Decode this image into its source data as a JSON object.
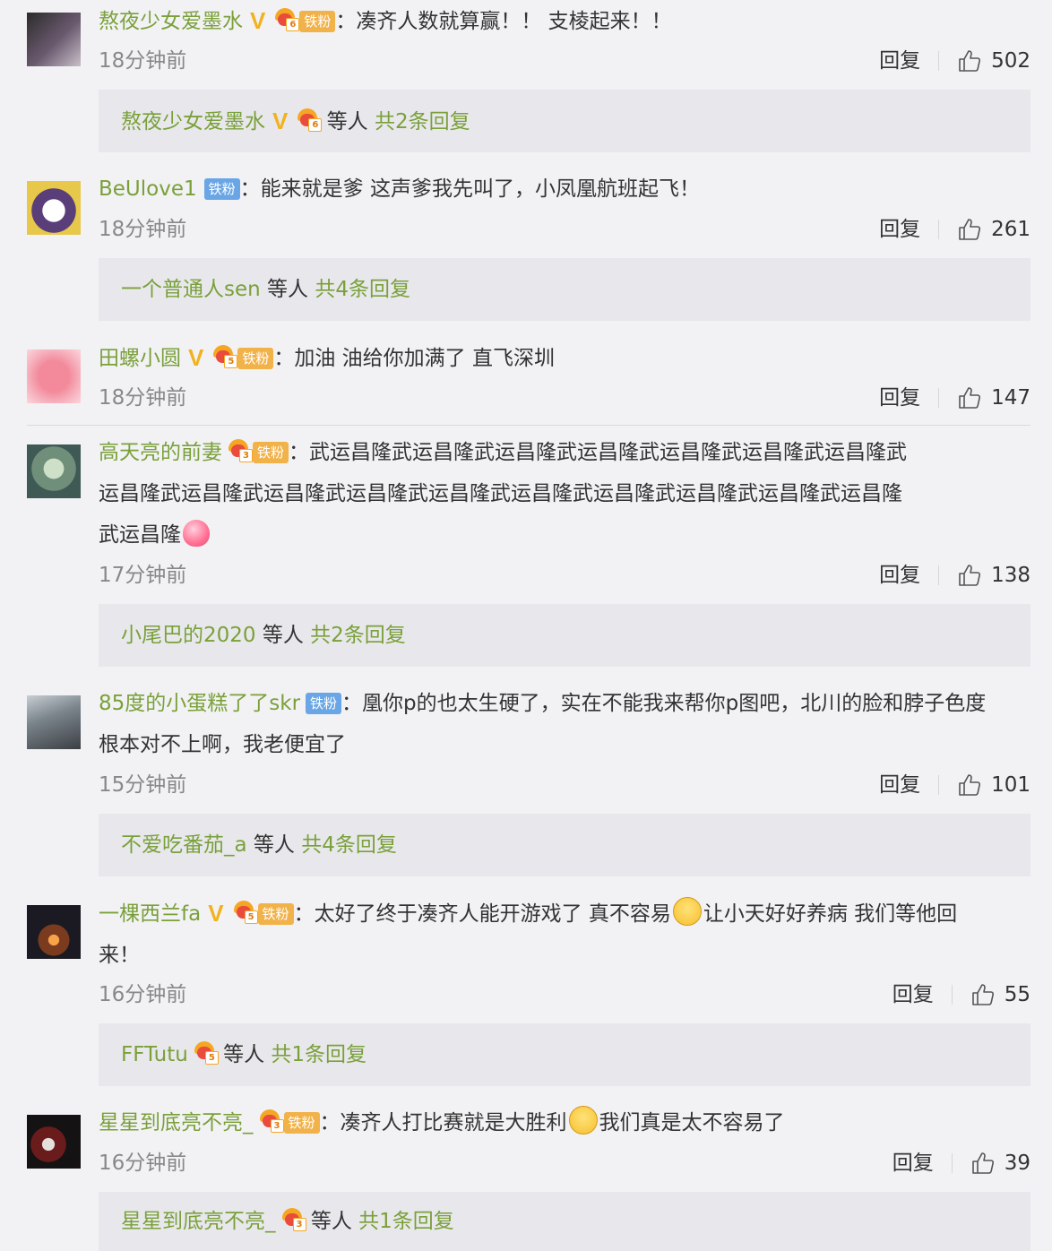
{
  "comments": [
    {
      "username": "熬夜少女爱墨水",
      "verified": true,
      "crown_level": "6",
      "fan_label": "铁粉",
      "fan_style": "gold",
      "text": "：凑齐人数就算赢！！ 支棱起来！！",
      "time": "18分钟前",
      "reply_label": "回复",
      "likes": "502",
      "sub": {
        "user": "熬夜少女爱墨水",
        "verified": true,
        "crown_level": "6",
        "etc": "等人",
        "count": "共2条回复"
      }
    },
    {
      "username": "BeUlove1",
      "verified": false,
      "crown_level": "",
      "fan_label": "铁粉",
      "fan_style": "blue",
      "text": "：能来就是爹 这声爹我先叫了，小凤凰航班起飞！",
      "time": "18分钟前",
      "reply_label": "回复",
      "likes": "261",
      "sub": {
        "user": "一个普通人sen",
        "verified": false,
        "crown_level": "",
        "etc": "等人",
        "count": "共4条回复"
      }
    },
    {
      "username": "田螺小圆",
      "verified": true,
      "crown_level": "5",
      "fan_label": "铁粉",
      "fan_style": "gold",
      "text": "：加油 油给你加满了 直飞深圳",
      "time": "18分钟前",
      "reply_label": "回复",
      "likes": "147"
    },
    {
      "username": "高天亮的前妻",
      "verified": false,
      "crown_level": "3",
      "fan_label": "铁粉",
      "fan_style": "gold",
      "text_lines": [
        "：武运昌隆武运昌隆武运昌隆武运昌隆武运昌隆武运昌隆武运昌隆武",
        "运昌隆武运昌隆武运昌隆武运昌隆武运昌隆武运昌隆武运昌隆武运昌隆武运昌隆武运昌隆",
        "武运昌隆"
      ],
      "emoji": "heart-emoji",
      "time": "17分钟前",
      "reply_label": "回复",
      "likes": "138",
      "sub": {
        "user": "小尾巴的2020",
        "verified": false,
        "crown_level": "",
        "etc": "等人",
        "count": "共2条回复"
      }
    },
    {
      "username": "85度的小蛋糕了了skr",
      "verified": false,
      "crown_level": "",
      "fan_label": "铁粉",
      "fan_style": "blue",
      "text_lines": [
        "：凰你p的也太生硬了，实在不能我来帮你p图吧，北川的脸和脖子色度",
        "根本对不上啊，我老便宜了"
      ],
      "time": "15分钟前",
      "reply_label": "回复",
      "likes": "101",
      "sub": {
        "user": "不爱吃番茄_a",
        "verified": false,
        "crown_level": "",
        "etc": "等人",
        "count": "共4条回复"
      }
    },
    {
      "username": "一棵西兰fa",
      "verified": true,
      "crown_level": "5",
      "fan_label": "铁粉",
      "fan_style": "gold",
      "text_a": "：太好了终于凑齐人能开游戏了 真不容易",
      "emoji": "cry-emoji",
      "text_b": "让小天好好养病 我们等他回",
      "text_c": "来！",
      "time": "16分钟前",
      "reply_label": "回复",
      "likes": "55",
      "sub": {
        "user": "FFTutu",
        "verified": false,
        "crown_level": "5",
        "etc": "等人",
        "count": "共1条回复"
      }
    },
    {
      "username": "星星到底亮不亮_",
      "verified": false,
      "crown_level": "3",
      "fan_label": "铁粉",
      "fan_style": "gold",
      "text_a": "：凑齐人打比赛就是大胜利",
      "emoji": "pleading-emoji",
      "text_b": "我们真是太不容易了",
      "time": "16分钟前",
      "reply_label": "回复",
      "likes": "39",
      "sub": {
        "user": "星星到底亮不亮_",
        "verified": false,
        "crown_level": "3",
        "etc": "等人",
        "count": "共1条回复"
      }
    }
  ],
  "colors": {
    "username": "#7aa03a",
    "background": "#f2f2f5",
    "sub_background": "#e8e8ec",
    "vip": "#f2b21d"
  }
}
